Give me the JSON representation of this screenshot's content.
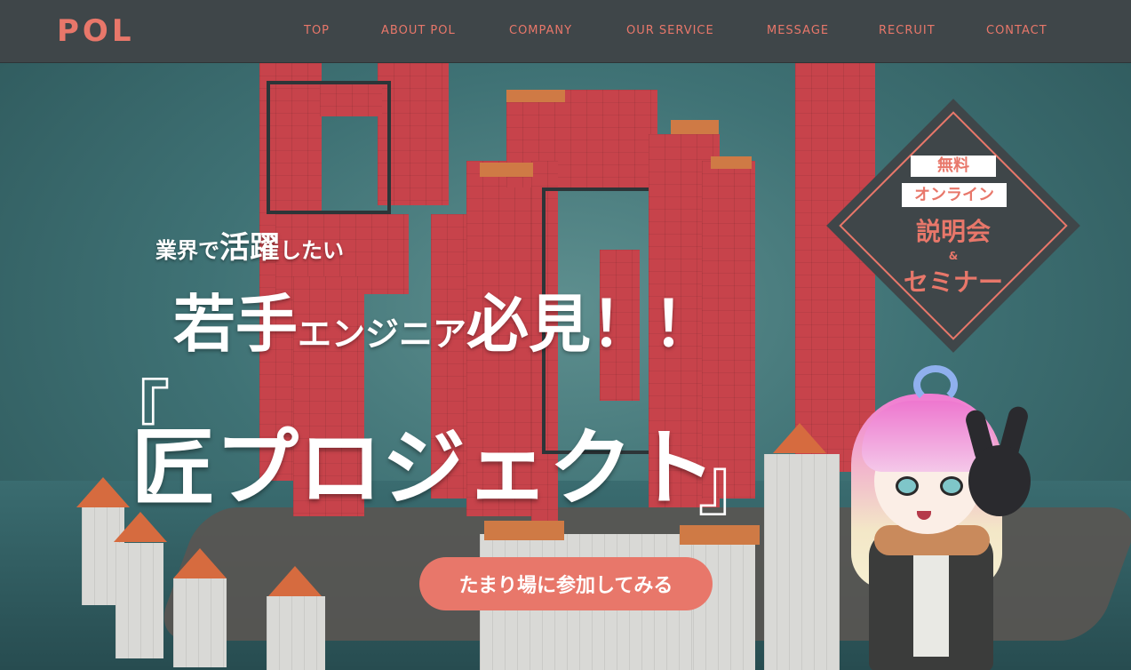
{
  "header": {
    "logo": "POL",
    "nav": [
      {
        "id": "top",
        "label": "TOP"
      },
      {
        "id": "about",
        "label": "ABOUT POL"
      },
      {
        "id": "company",
        "label": "COMPANY"
      },
      {
        "id": "service",
        "label": "OUR SERVICE"
      },
      {
        "id": "message",
        "label": "MESSAGE"
      },
      {
        "id": "recruit",
        "label": "RECRUIT"
      },
      {
        "id": "contact",
        "label": "CONTACT"
      }
    ]
  },
  "hero": {
    "line1_a": "業界で",
    "line1_b": "活躍",
    "line1_c": "したい",
    "line2_a": "若手",
    "line2_b": "エンジニア",
    "line2_c": "必見！！",
    "title": "匠プロジェクト",
    "bracket_open": "『",
    "bracket_close": "』",
    "cta": "たまり場に参加してみる"
  },
  "badge": {
    "free": "無料",
    "online": "オンライン",
    "session": "説明会",
    "amp": "&",
    "seminar": "セミナー"
  },
  "colors": {
    "accent": "#e8776a",
    "header_bg": "#3f4649",
    "tower_red": "#c7434b",
    "sea": "#3f7275"
  }
}
